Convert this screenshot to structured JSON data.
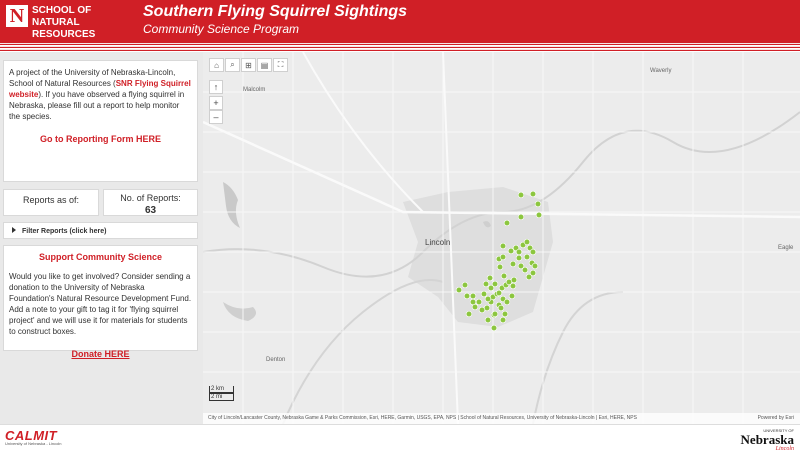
{
  "header": {
    "logo_letter": "N",
    "unit_name_line1": "SCHOOL OF",
    "unit_name_line2": "NATURAL RESOURCES",
    "title": "Southern Flying Squirrel Sightings",
    "subtitle": "Community Science Program",
    "brand_color": "#d01f26"
  },
  "intro": {
    "text_before": "A project of the University of Nebraska-Lincoln, School of Natural Resources (",
    "link": "SNR Flying Squirrel website",
    "text_after": "). If you have observed a flying squirrel in Nebraska, please fill out a report to help monitor the species.",
    "report_link": "Go to Reporting Form HERE"
  },
  "stats": {
    "as_of_label": "Reports as of:",
    "as_of_value": "",
    "count_label": "No. of Reports:",
    "count_value": "63"
  },
  "filter": {
    "label": "Filter Reports (click here)"
  },
  "support": {
    "title": "Support Community Science",
    "body": "Would you like to get involved? Consider sending a donation to the University of Nebraska Foundation's Natural Resource Development Fund. Add a note to your gift to tag it for 'flying squirrel project' and we will use it for materials for students to construct boxes.",
    "donate_link": "Donate HERE"
  },
  "map": {
    "toolbar_icons": [
      "home-icon",
      "search-icon",
      "select-icon",
      "layers-icon",
      "fullscreen-icon"
    ],
    "compass": "↑",
    "zoom_in": "+",
    "zoom_out": "–",
    "labels": {
      "malcolm": "Malcolm",
      "waverly": "Waverly",
      "lincoln": "Lincoln",
      "eagle": "Eagle",
      "denton": "Denton"
    },
    "scale_km": "2 km",
    "scale_mi": "2 mi",
    "attribution": "City of Lincoln/Lancaster County, Nebraska Game & Parks Commission, Esri, HERE, Garmin, USGS, EPA, NPS | School of Natural Resources, University of Nebraska-Lincoln | Esri, HERE, NPS",
    "powered_by": "Powered by Esri",
    "point_color": "#8cc63f"
  },
  "footer": {
    "calmit": "CALMIT",
    "calmit_sub": "University of Nebraska - Lincoln",
    "unl_small": "UNIVERSITY OF",
    "unl_main": "Nebraska",
    "unl_lincoln": "Lincoln"
  }
}
